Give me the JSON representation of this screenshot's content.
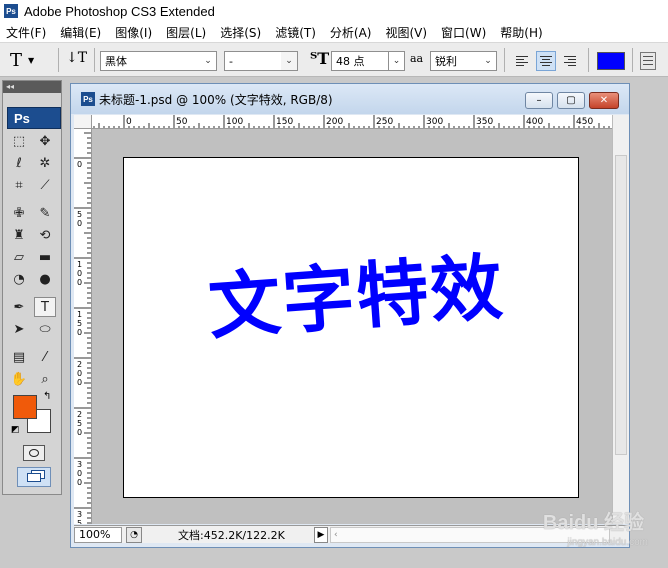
{
  "app": {
    "title": "Adobe Photoshop CS3 Extended",
    "logo": "Ps"
  },
  "menu": [
    "文件(F)",
    "编辑(E)",
    "图像(I)",
    "图层(L)",
    "选择(S)",
    "滤镜(T)",
    "分析(A)",
    "视图(V)",
    "窗口(W)",
    "帮助(H)"
  ],
  "options": {
    "tool_glyph": "T",
    "font_family": "黑体",
    "font_style": "-",
    "font_size": "48 点",
    "antialias": "锐利",
    "aa_label": "aa",
    "text_color": "#0000ff"
  },
  "tools_panel": {
    "logo": "Ps",
    "foreground_color": "#f05a0a",
    "background_color": "#ffffff",
    "tools": [
      {
        "name": "marquee-tool-icon",
        "glyph": "⬚"
      },
      {
        "name": "move-tool-icon",
        "glyph": "✥"
      },
      {
        "name": "lasso-tool-icon",
        "glyph": "ℓ"
      },
      {
        "name": "magic-wand-tool-icon",
        "glyph": "✲"
      },
      {
        "name": "crop-tool-icon",
        "glyph": "⌗"
      },
      {
        "name": "slice-tool-icon",
        "glyph": "⟋"
      },
      {
        "name": "healing-brush-tool-icon",
        "glyph": "✙"
      },
      {
        "name": "brush-tool-icon",
        "glyph": "✎"
      },
      {
        "name": "clone-stamp-tool-icon",
        "glyph": "♜"
      },
      {
        "name": "history-brush-tool-icon",
        "glyph": "⟲"
      },
      {
        "name": "eraser-tool-icon",
        "glyph": "▱"
      },
      {
        "name": "gradient-tool-icon",
        "glyph": "▬"
      },
      {
        "name": "blur-tool-icon",
        "glyph": "◔"
      },
      {
        "name": "dodge-tool-icon",
        "glyph": "●"
      },
      {
        "name": "pen-tool-icon",
        "glyph": "✒"
      },
      {
        "name": "type-tool-icon",
        "glyph": "T"
      },
      {
        "name": "path-selection-tool-icon",
        "glyph": "➤"
      },
      {
        "name": "ellipse-tool-icon",
        "glyph": "⬭"
      },
      {
        "name": "notes-tool-icon",
        "glyph": "▤"
      },
      {
        "name": "eyedropper-tool-icon",
        "glyph": "⁄"
      },
      {
        "name": "hand-tool-icon",
        "glyph": "✋"
      },
      {
        "name": "zoom-tool-icon",
        "glyph": "⌕"
      }
    ]
  },
  "document": {
    "title": "未标题-1.psd @ 100% (文字特效, RGB/8)",
    "logo": "Ps",
    "canvas_text": "文字特效",
    "canvas_text_color": "#0000ff",
    "zoom": "100%",
    "doc_info": "文档:452.2K/122.2K",
    "hruler_labels": [
      "0",
      "50",
      "100",
      "150",
      "200",
      "250",
      "300",
      "350",
      "400",
      "450"
    ],
    "vruler_labels": [
      "0",
      "5\n0",
      "1\n0\n0",
      "1\n5\n0",
      "2\n0\n0",
      "2\n5\n0",
      "3\n0\n0",
      "3\n5\n0"
    ]
  },
  "window_buttons": {
    "minimize": "–",
    "maximize": "▢",
    "close": "✕"
  },
  "watermark": {
    "main": "Baidu 经验",
    "sub": "jingyan.baidu.com"
  }
}
